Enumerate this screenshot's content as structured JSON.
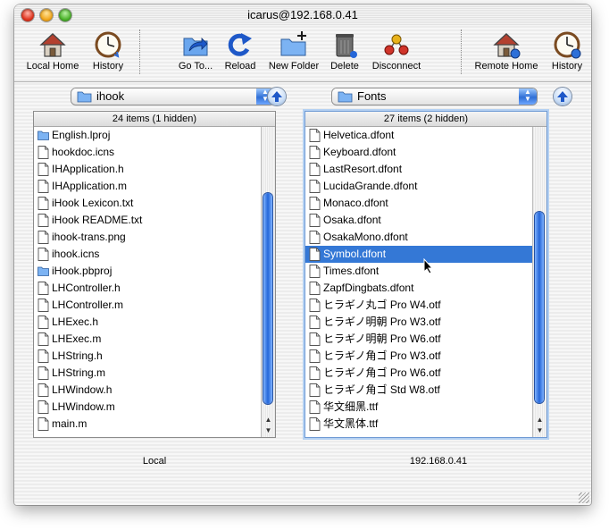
{
  "window": {
    "title": "icarus@192.168.0.41"
  },
  "toolbar": {
    "buttons": [
      {
        "label": "Local Home",
        "icon": "house-icon"
      },
      {
        "label": "History",
        "icon": "clock-icon"
      },
      {
        "label": "Go To...",
        "icon": "goto-folder-icon"
      },
      {
        "label": "Reload",
        "icon": "reload-icon"
      },
      {
        "label": "New Folder",
        "icon": "new-folder-icon"
      },
      {
        "label": "Delete",
        "icon": "trash-icon"
      },
      {
        "label": "Disconnect",
        "icon": "disconnect-icon"
      },
      {
        "label": "Remote Home",
        "icon": "remote-house-icon"
      },
      {
        "label": "History",
        "icon": "clock-icon"
      }
    ]
  },
  "local": {
    "path": "ihook",
    "header": "24 items (1 hidden)",
    "status": "Local",
    "files": [
      {
        "name": "English.lproj",
        "kind": "folder"
      },
      {
        "name": "hookdoc.icns",
        "kind": "file"
      },
      {
        "name": "IHApplication.h",
        "kind": "file"
      },
      {
        "name": "IHApplication.m",
        "kind": "file"
      },
      {
        "name": "iHook Lexicon.txt",
        "kind": "file"
      },
      {
        "name": "iHook README.txt",
        "kind": "file"
      },
      {
        "name": "ihook-trans.png",
        "kind": "file"
      },
      {
        "name": "ihook.icns",
        "kind": "file"
      },
      {
        "name": "iHook.pbproj",
        "kind": "folder"
      },
      {
        "name": "LHController.h",
        "kind": "file"
      },
      {
        "name": "LHController.m",
        "kind": "file"
      },
      {
        "name": "LHExec.h",
        "kind": "file"
      },
      {
        "name": "LHExec.m",
        "kind": "file"
      },
      {
        "name": "LHString.h",
        "kind": "file"
      },
      {
        "name": "LHString.m",
        "kind": "file"
      },
      {
        "name": "LHWindow.h",
        "kind": "file"
      },
      {
        "name": "LHWindow.m",
        "kind": "file"
      },
      {
        "name": "main.m",
        "kind": "file"
      }
    ]
  },
  "remote": {
    "path": "Fonts",
    "header": "27 items (2 hidden)",
    "status": "192.168.0.41",
    "selected": "Symbol.dfont",
    "files": [
      {
        "name": "Helvetica.dfont",
        "kind": "file"
      },
      {
        "name": "Keyboard.dfont",
        "kind": "file"
      },
      {
        "name": "LastResort.dfont",
        "kind": "file"
      },
      {
        "name": "LucidaGrande.dfont",
        "kind": "file"
      },
      {
        "name": "Monaco.dfont",
        "kind": "file"
      },
      {
        "name": "Osaka.dfont",
        "kind": "file"
      },
      {
        "name": "OsakaMono.dfont",
        "kind": "file"
      },
      {
        "name": "Symbol.dfont",
        "kind": "file"
      },
      {
        "name": "Times.dfont",
        "kind": "file"
      },
      {
        "name": "ZapfDingbats.dfont",
        "kind": "file"
      },
      {
        "name": "ヒラギノ丸ゴ Pro W4.otf",
        "kind": "file"
      },
      {
        "name": "ヒラギノ明朝 Pro W3.otf",
        "kind": "file"
      },
      {
        "name": "ヒラギノ明朝 Pro W6.otf",
        "kind": "file"
      },
      {
        "name": "ヒラギノ角ゴ Pro W3.otf",
        "kind": "file"
      },
      {
        "name": "ヒラギノ角ゴ Pro W6.otf",
        "kind": "file"
      },
      {
        "name": "ヒラギノ角ゴ Std W8.otf",
        "kind": "file"
      },
      {
        "name": "华文细黑.ttf",
        "kind": "file"
      },
      {
        "name": "华文黑体.ttf",
        "kind": "file"
      }
    ]
  }
}
